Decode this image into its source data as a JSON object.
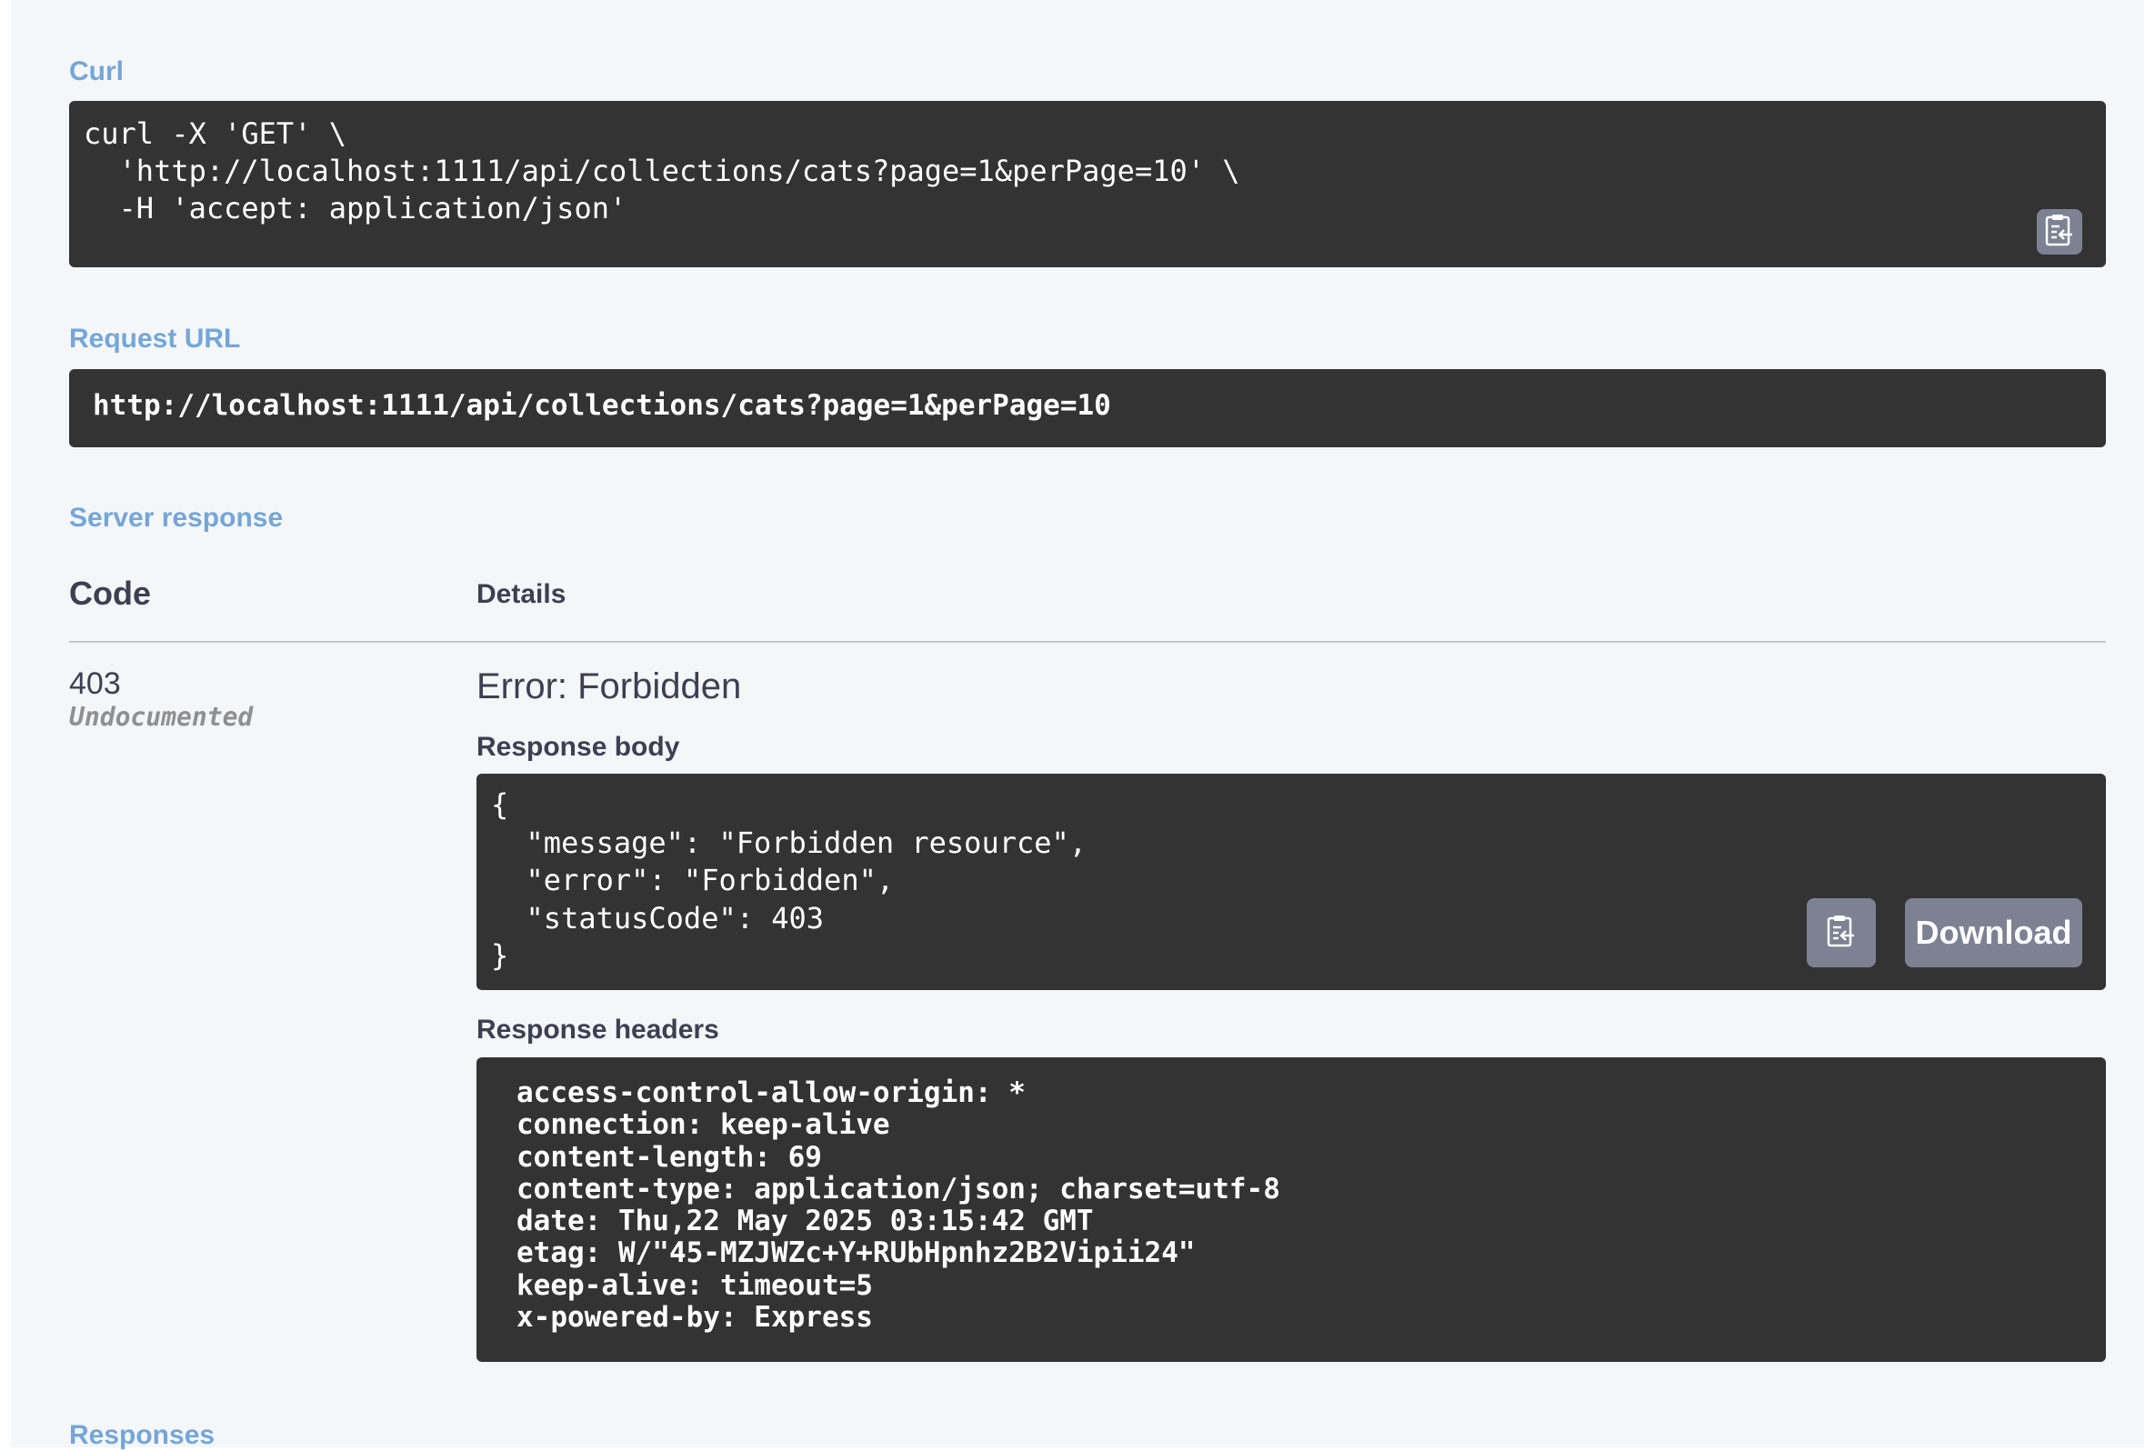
{
  "curl": {
    "label": "Curl",
    "command": "curl -X 'GET' \\\n  'http://localhost:1111/api/collections/cats?page=1&perPage=10' \\\n  -H 'accept: application/json'",
    "copy_icon": "clipboard-copy-icon"
  },
  "request_url": {
    "label": "Request URL",
    "value": "http://localhost:1111/api/collections/cats?page=1&perPage=10"
  },
  "server_response": {
    "label": "Server response",
    "code_header": "Code",
    "details_header": "Details",
    "code": "403",
    "code_note": "Undocumented",
    "error_title": "Error: Forbidden",
    "response_body_label": "Response body",
    "response_body": "{\n  \"message\": \"Forbidden resource\",\n  \"error\": \"Forbidden\",\n  \"statusCode\": 403\n}",
    "copy_icon": "clipboard-copy-icon",
    "download_label": "Download",
    "response_headers_label": "Response headers",
    "response_headers": "access-control-allow-origin: *\nconnection: keep-alive\ncontent-length: 69\ncontent-type: application/json; charset=utf-8\ndate: Thu,22 May 2025 03:15:42 GMT\netag: W/\"45-MZJWZc+Y+RUbHpnhz2B2Vipii24\"\nkeep-alive: timeout=5\nx-powered-by: Express"
  },
  "responses": {
    "label": "Responses"
  },
  "colors": {
    "section_label": "#74a7d8",
    "code_block_bg": "#333333",
    "button_bg": "#7d8293",
    "panel_bg": "#f5f6f8"
  }
}
